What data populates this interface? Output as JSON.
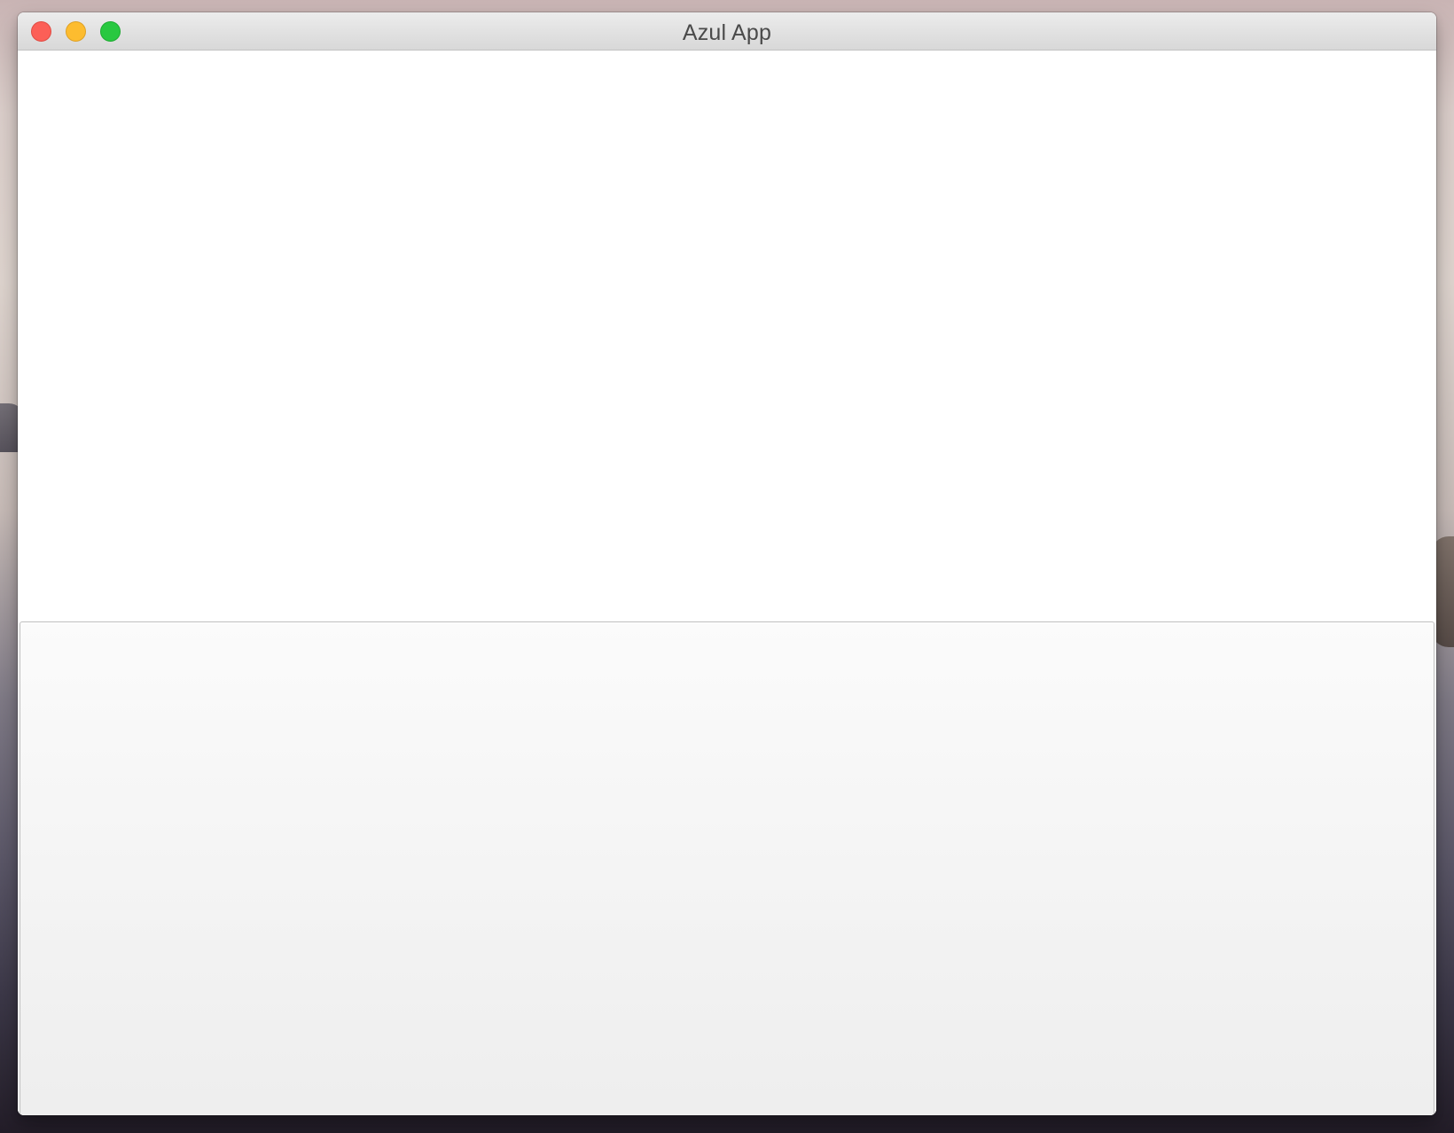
{
  "window": {
    "title": "Azul App"
  },
  "controls": {
    "close": {
      "color": "#fc5f57"
    },
    "minimize": {
      "color": "#fdbc2f"
    },
    "maximize": {
      "color": "#28c840"
    }
  },
  "content": {
    "upper_area": "",
    "lower_panel": ""
  }
}
